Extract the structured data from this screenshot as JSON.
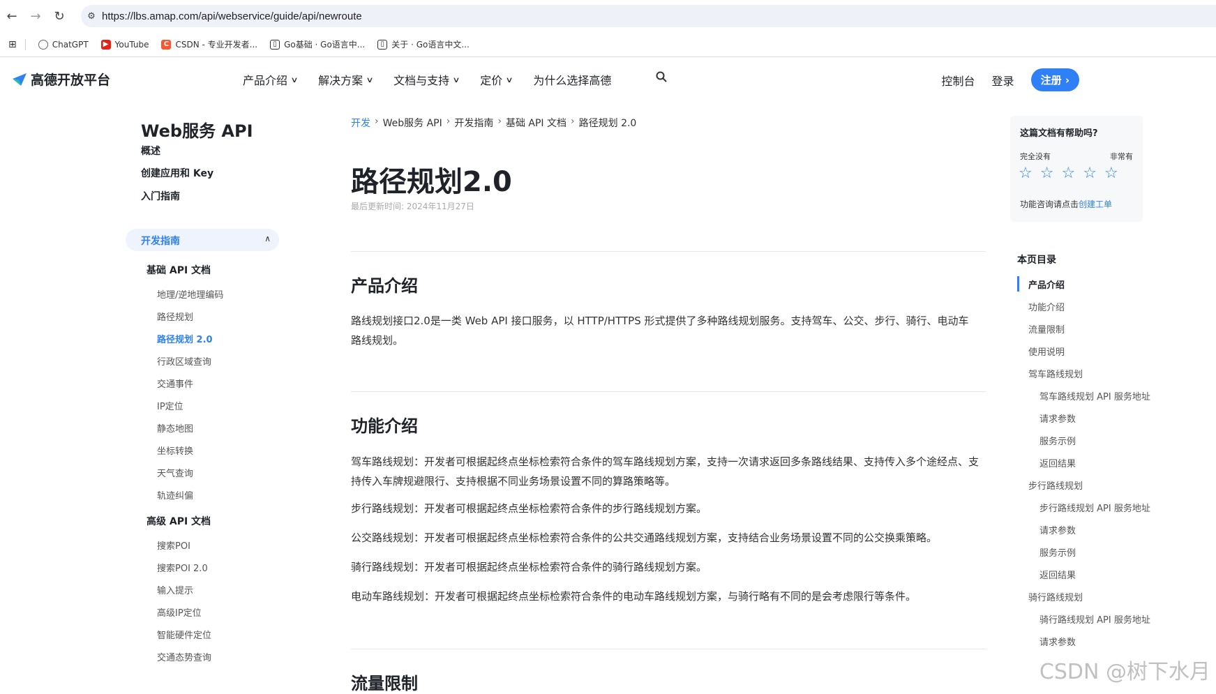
{
  "browser": {
    "url": "https://lbs.amap.com/api/webservice/guide/api/newroute",
    "bookmarks": [
      "ChatGPT",
      "YouTube",
      "CSDN - 专业开发者...",
      "Go基础 · Go语言中...",
      "关于 · Go语言中文..."
    ]
  },
  "header": {
    "logo": "高德开放平台",
    "menu": [
      "产品介绍",
      "解决方案",
      "文档与支持",
      "定价",
      "为什么选择高德"
    ],
    "console": "控制台",
    "login": "登录",
    "register": "注册"
  },
  "sidebar": {
    "title": "Web服务 API",
    "top_items": [
      "概述",
      "创建应用和 Key",
      "入门指南"
    ],
    "active_group": "开发指南",
    "basic_group": "基础 API 文档",
    "basic_items": [
      "地理/逆地理编码",
      "路径规划",
      "路径规划 2.0",
      "行政区域查询",
      "交通事件",
      "IP定位",
      "静态地图",
      "坐标转换",
      "天气查询",
      "轨迹纠偏"
    ],
    "advanced_group": "高级 API 文档",
    "advanced_items": [
      "搜索POI",
      "搜索POI 2.0",
      "输入提示",
      "高级IP定位",
      "智能硬件定位",
      "交通态势查询"
    ]
  },
  "breadcrumb": [
    "开发",
    "Web服务 API",
    "开发指南",
    "基础 API 文档",
    "路径规划 2.0"
  ],
  "page": {
    "title": "路径规划2.0",
    "updated": "最后更新时间: 2024年11月27日",
    "sections": [
      {
        "heading": "产品介绍",
        "paragraphs": [
          "路线规划接口2.0是一类 Web API 接口服务，以 HTTP/HTTPS 形式提供了多种路线规划服务。支持驾车、公交、步行、骑行、电动车路线规划。"
        ]
      },
      {
        "heading": "功能介绍",
        "paragraphs": [
          "驾车路线规划：开发者可根据起终点坐标检索符合条件的驾车路线规划方案，支持一次请求返回多条路线结果、支持传入多个途经点、支持传入车牌规避限行、支持根据不同业务场景设置不同的算路策略等。",
          "步行路线规划：开发者可根据起终点坐标检索符合条件的步行路线规划方案。",
          "公交路线规划：开发者可根据起终点坐标检索符合条件的公共交通路线规划方案，支持结合业务场景设置不同的公交换乘策略。",
          "骑行路线规划：开发者可根据起终点坐标检索符合条件的骑行路线规划方案。",
          "电动车路线规划：开发者可根据起终点坐标检索符合条件的电动车路线规划方案，与骑行略有不同的是会考虑限行等条件。"
        ]
      },
      {
        "heading": "流量限制",
        "paragraphs": []
      }
    ]
  },
  "rating": {
    "question": "这篇文档有帮助吗?",
    "low": "完全没有",
    "high": "非常有",
    "help_prefix": "功能咨询请点击",
    "help_link": "创建工单"
  },
  "toc": {
    "title": "本页目录",
    "items": [
      {
        "label": "产品介绍",
        "level": 1,
        "active": true
      },
      {
        "label": "功能介绍",
        "level": 1
      },
      {
        "label": "流量限制",
        "level": 1
      },
      {
        "label": "使用说明",
        "level": 1
      },
      {
        "label": "驾车路线规划",
        "level": 1
      },
      {
        "label": "驾车路线规划 API 服务地址",
        "level": 2
      },
      {
        "label": "请求参数",
        "level": 2
      },
      {
        "label": "服务示例",
        "level": 2
      },
      {
        "label": "返回结果",
        "level": 2
      },
      {
        "label": "步行路线规划",
        "level": 1
      },
      {
        "label": "步行路线规划 API 服务地址",
        "level": 2
      },
      {
        "label": "请求参数",
        "level": 2
      },
      {
        "label": "服务示例",
        "level": 2
      },
      {
        "label": "返回结果",
        "level": 2
      },
      {
        "label": "骑行路线规划",
        "level": 1
      },
      {
        "label": "骑行路线规划 API 服务地址",
        "level": 2
      },
      {
        "label": "请求参数",
        "level": 2
      }
    ]
  },
  "watermark": "CSDN @树下水月",
  "colors": {
    "accent": "#2f80f6",
    "text": "#1f2329"
  }
}
